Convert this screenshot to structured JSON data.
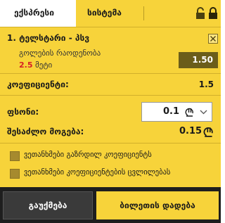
{
  "tabs": {
    "express": "ექსპრესი",
    "system": "სისტემა"
  },
  "selection": {
    "number": "1.",
    "event": "ტელსტარი - პსვ",
    "market": "გოლების რაოდენობა",
    "line": "2.5",
    "outcome": "მეტი",
    "odds": "1.50"
  },
  "coefficient": {
    "label": "კოეფიციენტი:",
    "value": "1.5"
  },
  "stake": {
    "label": "ფსონი:",
    "value": "0.1"
  },
  "possible_win": {
    "label": "შესაძლო მოგება:",
    "value": "0.15"
  },
  "options": {
    "agree_higher": "ვეთანხმები გაზრდილ კოეფიციენტს",
    "agree_change": "ვეთანხმები კოეფიციენტების ცვლილებას"
  },
  "buttons": {
    "cancel": "გაუქმება",
    "place_bet": "ბილეთის დადება"
  },
  "colors": {
    "accent": "#f7d33a",
    "odds_box": "#6b5d1a",
    "line_highlight": "#d61f26",
    "bottom_bar": "#1e1e1e"
  },
  "icons": [
    "unlock-icon",
    "lock-icon",
    "close-icon",
    "lari-currency-icon",
    "chevron-down-icon"
  ]
}
